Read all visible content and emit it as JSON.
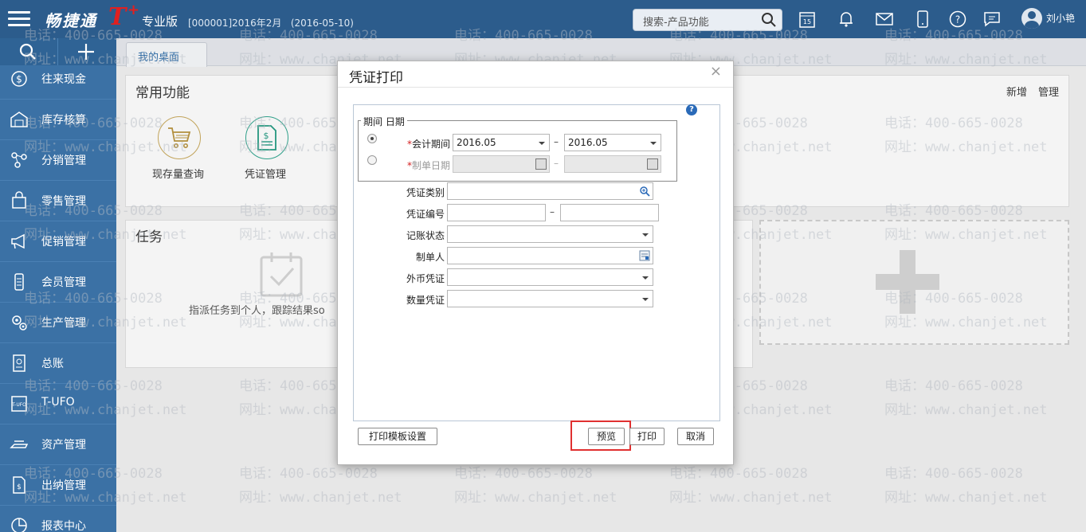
{
  "header": {
    "logo_text": "畅捷通",
    "logo_mark": "T",
    "logo_plus": "+",
    "edition": "专业版",
    "account_info": "[000001]2016年2月",
    "date_info": "(2016-05-10)",
    "search_placeholder": "搜索-产品功能",
    "calendar_day": "15",
    "user_name": "刘小艳"
  },
  "sidebar": {
    "items": [
      {
        "label": "往来现金",
        "icon": "dollar-circle-icon"
      },
      {
        "label": "库存核算",
        "icon": "warehouse-icon"
      },
      {
        "label": "分销管理",
        "icon": "distribution-icon"
      },
      {
        "label": "零售管理",
        "icon": "retail-icon"
      },
      {
        "label": "促销管理",
        "icon": "megaphone-icon"
      },
      {
        "label": "会员管理",
        "icon": "member-icon"
      },
      {
        "label": "生产管理",
        "icon": "gears-icon"
      },
      {
        "label": "总账",
        "icon": "ledger-icon"
      },
      {
        "label": "T-UFO",
        "icon": "tufo-icon"
      },
      {
        "label": "资产管理",
        "icon": "asset-icon"
      },
      {
        "label": "出纳管理",
        "icon": "cashier-icon"
      },
      {
        "label": "报表中心",
        "icon": "pie-chart-icon"
      }
    ]
  },
  "tabs": {
    "desktop": "我的桌面"
  },
  "common_functions": {
    "title": "常用功能",
    "add": "新增",
    "manage": "管理",
    "items": [
      {
        "label": "现存量查询",
        "icon": "cart-icon"
      },
      {
        "label": "凭证管理",
        "icon": "voucher-icon"
      }
    ]
  },
  "tasks": {
    "title": "任务",
    "hint": "指派任务到个人，跟踪结果so"
  },
  "watermark": {
    "phone": "电话：400-665-0028",
    "site": "网址：www.chanjet.net"
  },
  "dialog": {
    "title": "凭证打印",
    "close": "×",
    "help": "?",
    "legend": "期间 日期",
    "period_label": "会计期间",
    "period_from": "2016.05",
    "period_to": "2016.05",
    "date_label": "制单日期",
    "range_sep": "–",
    "required_mark": "*",
    "fields": {
      "voucher_type": "凭证类别",
      "voucher_no": "凭证编号",
      "posting_status": "记账状态",
      "maker": "制单人",
      "foreign_currency": "外币凭证",
      "quantity": "数量凭证"
    },
    "buttons": {
      "template": "打印模板设置",
      "preview": "预览",
      "print": "打印",
      "cancel": "取消"
    }
  }
}
